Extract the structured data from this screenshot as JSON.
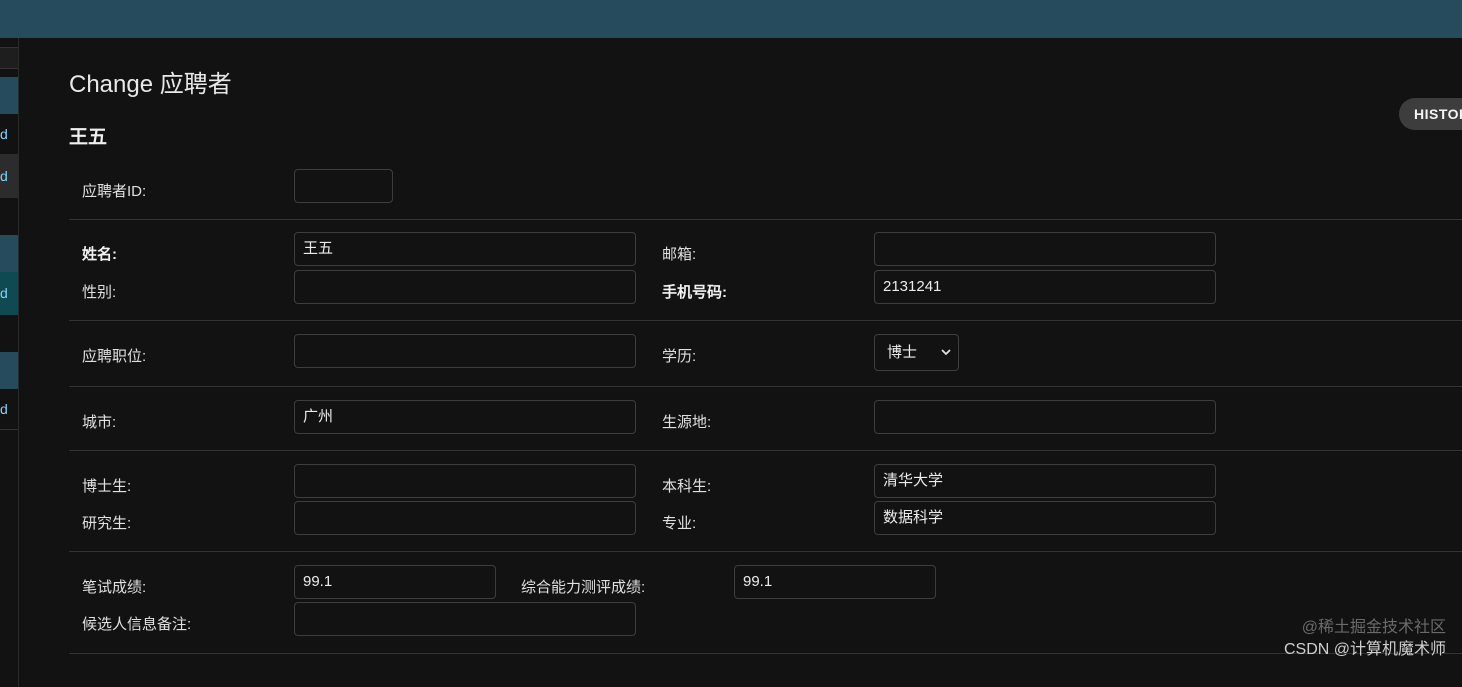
{
  "page": {
    "title": "Change 应聘者",
    "object_name": "王五",
    "history_label": "HISTORY"
  },
  "sidebar": {
    "items": [
      {
        "label": "d"
      },
      {
        "label": "d"
      },
      {
        "label": "d"
      },
      {
        "label": "d"
      }
    ]
  },
  "form": {
    "applicant_id": {
      "label": "应聘者ID:",
      "value": ""
    },
    "name": {
      "label": "姓名:",
      "value": "王五"
    },
    "email": {
      "label": "邮箱:",
      "value": ""
    },
    "gender": {
      "label": "性别:",
      "value": ""
    },
    "phone": {
      "label": "手机号码:",
      "value": "2131241"
    },
    "position": {
      "label": "应聘职位:",
      "value": ""
    },
    "degree": {
      "label": "学历:",
      "value": "博士"
    },
    "city": {
      "label": "城市:",
      "value": "广州"
    },
    "origin": {
      "label": "生源地:",
      "value": ""
    },
    "phd": {
      "label": "博士生:",
      "value": ""
    },
    "bachelor": {
      "label": "本科生:",
      "value": "清华大学"
    },
    "master": {
      "label": "研究生:",
      "value": ""
    },
    "major": {
      "label": "专业:",
      "value": "数据科学"
    },
    "written_score": {
      "label": "笔试成绩:",
      "value": "99.1"
    },
    "ability_score": {
      "label": "综合能力测评成绩:",
      "value": "99.1"
    },
    "candidate_note": {
      "label": "候选人信息备注:",
      "value": ""
    }
  },
  "watermark": {
    "line1": "@稀土掘金技术社区",
    "line2": "CSDN @计算机魔术师"
  }
}
